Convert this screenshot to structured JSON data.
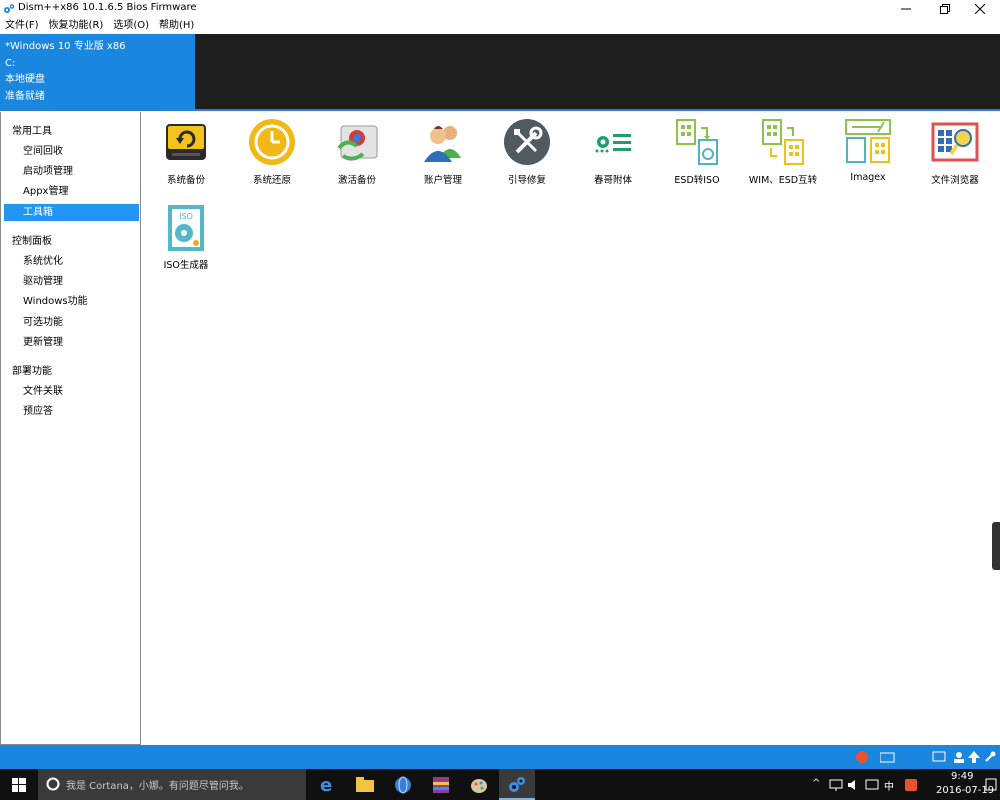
{
  "window": {
    "title": "Dism++x86 10.1.6.5 Bios Firmware"
  },
  "menu": [
    "文件(F)",
    "恢复功能(R)",
    "选项(O)",
    "帮助(H)"
  ],
  "header": {
    "os_name": "*Windows 10 专业版 x86",
    "drive": "C:",
    "disk_type": "本地硬盘",
    "status": "准备就绪"
  },
  "sidebar": {
    "groups": [
      {
        "label": "常用工具",
        "items": [
          "空间回收",
          "启动项管理",
          "Appx管理",
          "工具箱"
        ]
      },
      {
        "label": "控制面板",
        "items": [
          "系统优化",
          "驱动管理",
          "Windows功能",
          "可选功能",
          "更新管理"
        ]
      },
      {
        "label": "部署功能",
        "items": [
          "文件关联",
          "预应答"
        ]
      }
    ],
    "active_item": "工具箱"
  },
  "tools": [
    {
      "label": "系统备份",
      "icon": "disk-backup-icon"
    },
    {
      "label": "系统还原",
      "icon": "clock-restore-icon"
    },
    {
      "label": "激活备份",
      "icon": "activation-backup-icon"
    },
    {
      "label": "账户管理",
      "icon": "users-icon"
    },
    {
      "label": "引导修复",
      "icon": "wrench-screwdriver-icon"
    },
    {
      "label": "春哥附体",
      "icon": "toggle-lines-icon"
    },
    {
      "label": "ESD转ISO",
      "icon": "esd-to-iso-icon"
    },
    {
      "label": "WIM、ESD互转",
      "icon": "wim-esd-convert-icon"
    },
    {
      "label": "Imagex",
      "icon": "imagex-icon"
    },
    {
      "label": "文件浏览器",
      "icon": "file-browser-icon"
    },
    {
      "label": "ISO生成器",
      "icon": "iso-generator-icon"
    }
  ],
  "taskbar": {
    "search_placeholder": "我是 Cortana，小娜。有问题尽管问我。",
    "ime": "中",
    "time": "9:49",
    "date": "2016-07-19"
  },
  "colors": {
    "accent": "#1b86de",
    "header_dark": "#1e1e1e",
    "selected": "#2196f3",
    "taskbar": "#101010"
  }
}
